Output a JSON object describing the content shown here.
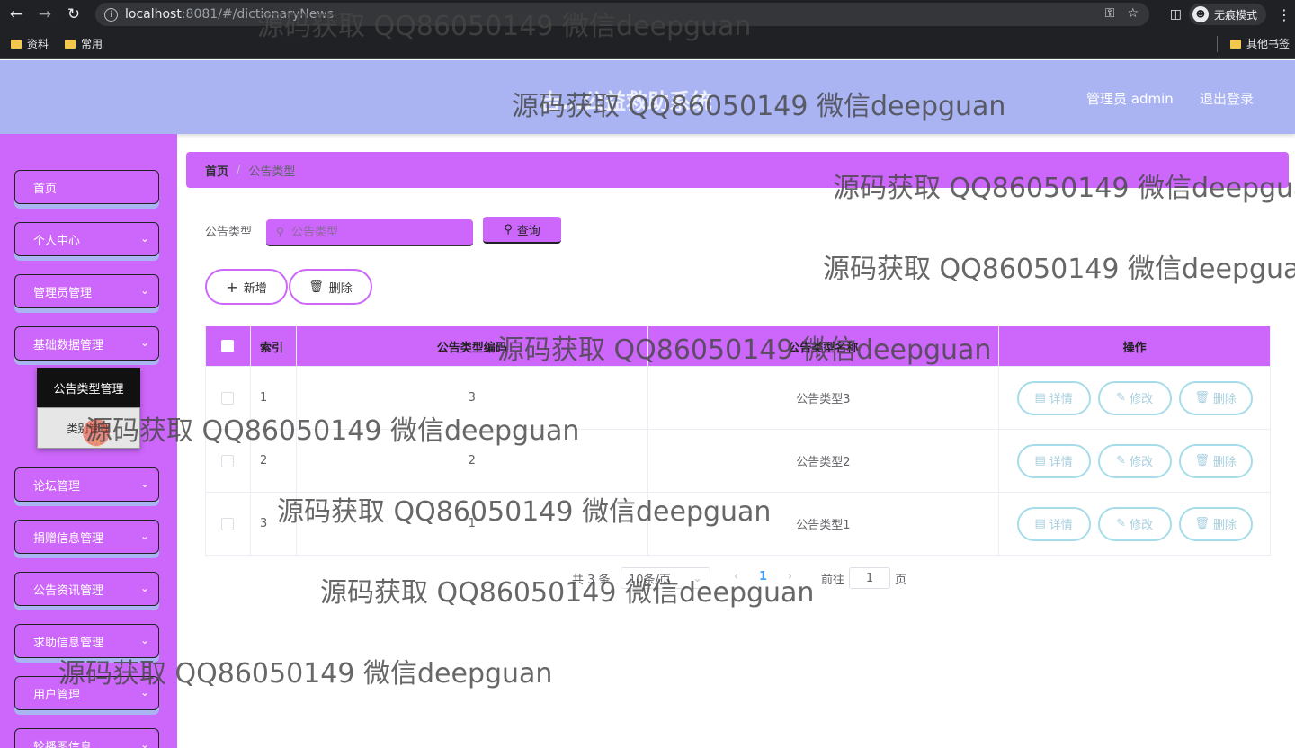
{
  "browser": {
    "url_host": "localhost",
    "url_path": ":8081/#/dictionaryNews",
    "incognito_label": "无痕模式",
    "bookmarks": [
      "资料",
      "常用"
    ],
    "other_bookmarks": "其他书签"
  },
  "header": {
    "title": "吉…公益救助系统",
    "user": "管理员 admin",
    "logout": "退出登录"
  },
  "sidebar": {
    "items": [
      {
        "label": "首页",
        "has_chevron": false
      },
      {
        "label": "个人中心",
        "has_chevron": true
      },
      {
        "label": "管理员管理",
        "has_chevron": true
      },
      {
        "label": "基础数据管理",
        "has_chevron": true
      },
      {
        "label": "论坛管理",
        "has_chevron": true
      },
      {
        "label": "捐赠信息管理",
        "has_chevron": true
      },
      {
        "label": "公告资讯管理",
        "has_chevron": true
      },
      {
        "label": "求助信息管理",
        "has_chevron": true
      },
      {
        "label": "用户管理",
        "has_chevron": true
      },
      {
        "label": "轮播图信息",
        "has_chevron": true
      }
    ],
    "submenu": [
      "公告类型管理",
      "类别管理"
    ]
  },
  "breadcrumb": {
    "home": "首页",
    "sep": "/",
    "current": "公告类型"
  },
  "search": {
    "label": "公告类型",
    "placeholder": "公告类型",
    "query_button": "查询"
  },
  "actions": {
    "add": "新增",
    "delete": "删除"
  },
  "table": {
    "headers": [
      "索引",
      "公告类型编码",
      "公告类型名称",
      "操作"
    ],
    "rows": [
      {
        "index": "1",
        "code": "3",
        "name": "公告类型3"
      },
      {
        "index": "2",
        "code": "2",
        "name": "公告类型2"
      },
      {
        "index": "3",
        "code": "1",
        "name": "公告类型1"
      }
    ],
    "row_actions": {
      "detail": "详情",
      "edit": "修改",
      "delete": "删除"
    }
  },
  "pagination": {
    "total": "共 3 条",
    "page_size": "10条/页",
    "current_page": "1",
    "goto_label": "前往",
    "goto_value": "1",
    "page_suffix": "页"
  },
  "watermark": "源码获取 QQ86050149 微信deepguan",
  "colors": {
    "accent": "#cd66fb",
    "header_bg": "#aab4f3",
    "row_button_border": "#a7dce9"
  }
}
